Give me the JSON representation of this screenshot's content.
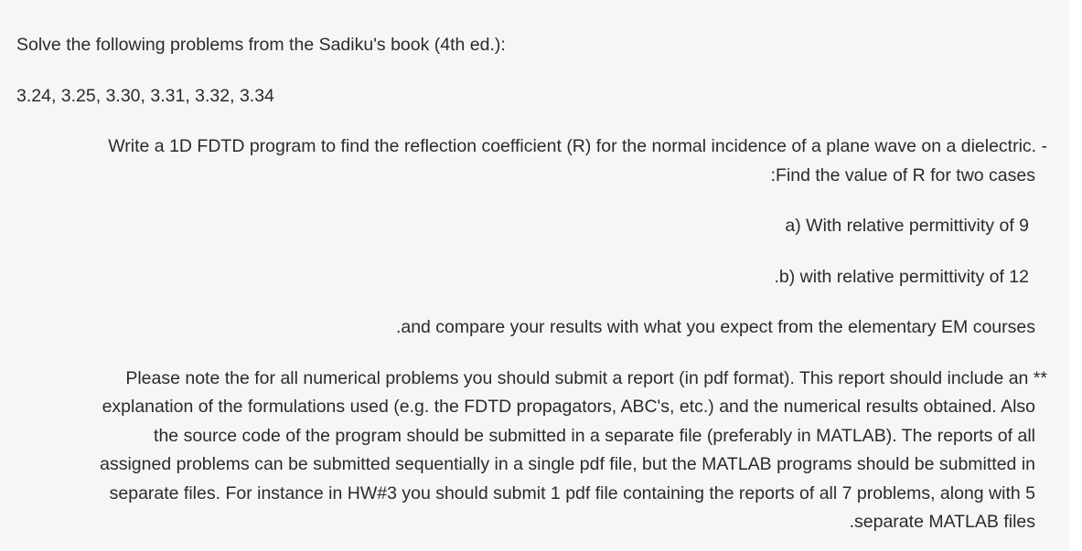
{
  "heading": "Solve the following problems from the Sadiku's book (4th ed.):",
  "problems": "3.24, 3.25, 3.30, 3.31, 3.32, 3.34",
  "fdtd": {
    "line1": "Write a 1D FDTD program to find the reflection coefficient (R) for the normal incidence of a plane wave on a dielectric.  -",
    "line2": ":Find the value of R for two cases",
    "case_a": "a) With relative permittivity of 9",
    "case_b": ".b) with relative permittivity of 12",
    "compare": ".and compare your results with what you expect from the elementary EM courses"
  },
  "note": {
    "line1": "Please note the for all numerical problems you should submit a report (in pdf format). This report should include an **",
    "line2": "explanation of the formulations used (e.g. the FDTD propagators, ABC's, etc.) and the numerical results obtained. Also",
    "line3": "the source code of the program should be submitted in a separate file (preferably in MATLAB).  The reports of all",
    "line4": "assigned problems can be submitted sequentially in a single pdf file, but the MATLAB programs should be submitted in",
    "line5": "separate files. For instance in HW#3 you should submit 1 pdf file containing the reports of all 7 problems, along with 5",
    "line6": ".separate MATLAB files"
  }
}
